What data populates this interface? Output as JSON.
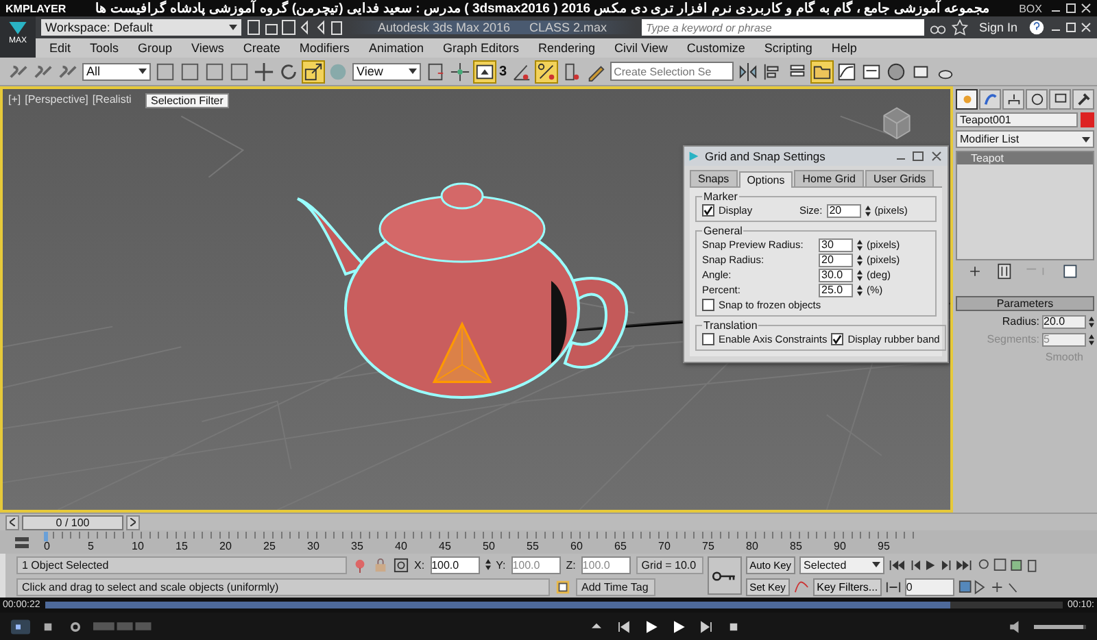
{
  "player": {
    "brand": "KMPLAYER",
    "title": "مجموعه آموزشی جامع ، گام به گام و کاربردی نرم افزار تری دی مکس 2016 ( 3dsmax2016 )  مدرس : سعید فدایی (تیچرمن) گروه آموزشی پادشاه گرافیست ها",
    "box_label": "BOX"
  },
  "app": {
    "logo_label": "MAX",
    "workspace": "Workspace: Default",
    "title": "Autodesk 3ds Max 2016",
    "file": "CLASS 2.max",
    "search": {
      "placeholder": "Type a keyword or phrase"
    },
    "sign_in": "Sign In"
  },
  "menu": [
    "Edit",
    "Tools",
    "Group",
    "Views",
    "Create",
    "Modifiers",
    "Animation",
    "Graph Editors",
    "Rendering",
    "Civil View",
    "Customize",
    "Scripting",
    "Help"
  ],
  "toolbar": {
    "filter": "All",
    "coord": "View",
    "selection_set": {
      "placeholder": "Create Selection Se"
    },
    "snap_digit": "3"
  },
  "viewport": {
    "labels": [
      "[+]",
      "[Perspective]",
      "[Realisti"
    ],
    "tooltip": "Selection Filter"
  },
  "dialog": {
    "title": "Grid and Snap Settings",
    "tabs": [
      {
        "label": "Snaps",
        "selected": false
      },
      {
        "label": "Options",
        "selected": true
      },
      {
        "label": "Home Grid",
        "selected": false
      },
      {
        "label": "User Grids",
        "selected": false
      }
    ],
    "marker": {
      "title": "Marker",
      "display": {
        "label": "Display",
        "checked": true
      },
      "size_label": "Size:",
      "size": "20",
      "unit": "(pixels)"
    },
    "general": {
      "title": "General",
      "fields": [
        {
          "label": "Snap Preview Radius:",
          "value": "30",
          "unit": "(pixels)"
        },
        {
          "label": "Snap Radius:",
          "value": "20",
          "unit": "(pixels)"
        },
        {
          "label": "Angle:",
          "value": "30.0",
          "unit": "(deg)"
        },
        {
          "label": "Percent:",
          "value": "25.0",
          "unit": "(%)"
        }
      ],
      "frozen": {
        "label": "Snap to frozen objects",
        "checked": false
      }
    },
    "translation": {
      "title": "Translation",
      "options": [
        {
          "label": "Enable Axis Constraints",
          "checked": false
        },
        {
          "label": "Display rubber band",
          "checked": true
        }
      ]
    }
  },
  "command_panel": {
    "tabs": [
      {
        "selected": true
      },
      {
        "selected": false
      },
      {
        "selected": false
      },
      {
        "selected": false
      },
      {
        "selected": false
      },
      {
        "selected": false
      }
    ],
    "name": "Teapot001",
    "modifier_list": "Modifier List",
    "stack": [
      {
        "label": "Teapot",
        "selected": true
      }
    ],
    "rollout": "Parameters",
    "params": [
      {
        "label": "Radius:",
        "value": "20.0",
        "disabled": false
      },
      {
        "label": "Segments:",
        "value": "5",
        "disabled": true
      }
    ],
    "smooth": "Smooth"
  },
  "timeline": {
    "slider": "0 / 100",
    "ticks": [
      "0",
      "5",
      "10",
      "15",
      "20",
      "25",
      "30",
      "35",
      "40",
      "45",
      "50",
      "55",
      "60",
      "65",
      "70",
      "75",
      "80",
      "85",
      "90",
      "95"
    ]
  },
  "status": {
    "selection": "1 Object Selected",
    "prompt": "Click and drag to select and scale objects (uniformly)",
    "coords": [
      {
        "axis": "X:",
        "value": "100.0",
        "disabled": false
      },
      {
        "axis": "Y:",
        "value": "100.0",
        "disabled": true
      },
      {
        "axis": "Z:",
        "value": "100.0",
        "disabled": true
      }
    ],
    "grid": "Grid = 10.0",
    "add_time_tag": "Add Time Tag"
  },
  "animation": {
    "auto_key": "Auto Key",
    "set_key": "Set Key",
    "key_mode": "Selected",
    "key_filters": "Key Filters...",
    "frame": "0"
  },
  "playback": {
    "elapsed": "00:00:22",
    "total": "00:10:",
    "level": 0.89,
    "volume": {
      "level": 0.95
    }
  }
}
